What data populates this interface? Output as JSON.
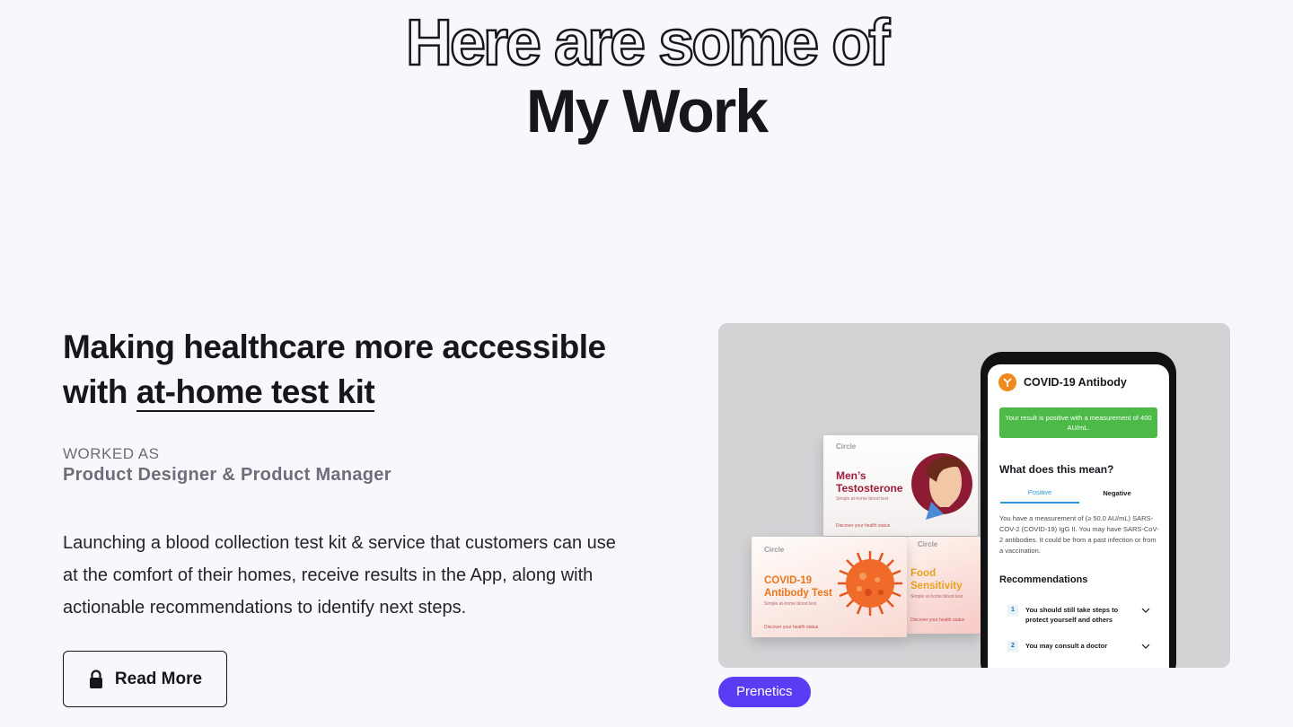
{
  "header": {
    "outline_title": "Here are some of",
    "solid_title": "My Work"
  },
  "project": {
    "title_part1": "Making healthcare more accessible with ",
    "title_highlight": "at-home test kit",
    "role_caption": "WORKED AS",
    "role": "Product Designer & Product Manager",
    "description": "Launching a blood collection test kit & service that customers can use at the comfort of their homes, receive results in the App, along with actionable recommendations to identify next steps.",
    "read_more_label": "Read More",
    "tag_label": "Prenetics"
  },
  "mockup": {
    "boxes": {
      "back_brand": "Circle",
      "back_title": "Men’s Testosterone",
      "back_sub": "Simple at-home blood test",
      "back_foot": "Discover your health status",
      "front_brand": "Circle",
      "front_title": "COVID-19 Antibody Test",
      "front_sub": "Simple at-home blood test",
      "front_foot": "Discover your health status",
      "right_brand": "Circle",
      "right_title": "Food Sensitivity",
      "right_sub": "Simple at-home blood test",
      "right_foot": "Discover your health status"
    },
    "app": {
      "title": "COVID-19 Antibody",
      "result": "Your result is positive with a measurement of 400 AU/mL.",
      "question": "What does this mean?",
      "tab_positive": "Positive",
      "tab_negative": "Negative",
      "explanation": "You have a measurement of (≥ 50.0 AU/mL) SARS-COV-2 (COVID-19) IgG II. You may have SARS-CoV-2 antibodies. It could be from a past infection or from a vaccination.",
      "recommendations_title": "Recommendations",
      "recommendations": [
        {
          "num": "1",
          "text": "You should still take steps to protect yourself and others"
        },
        {
          "num": "2",
          "text": "You may consult a doctor"
        }
      ]
    }
  },
  "colors": {
    "background": "#f7f7fc",
    "text": "#16161d",
    "accent": "#5b3cf5",
    "result_green": "#4cba47"
  },
  "icons": [
    "lock-icon",
    "antibody-icon",
    "chevron-down-icon",
    "virus-icon",
    "man-avatar-icon"
  ]
}
